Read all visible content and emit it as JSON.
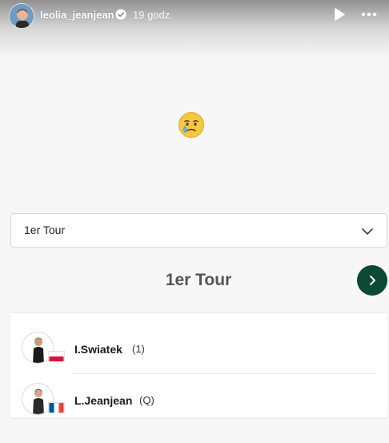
{
  "story": {
    "username": "leolia_jeanjean",
    "time_ago": "19 godz."
  },
  "round_select": {
    "selected": "1er Tour"
  },
  "round_heading": {
    "title": "1er Tour"
  },
  "match": {
    "players": [
      {
        "name": "I.Swiatek",
        "seed": "(1)",
        "flag": "poland-flag-icon"
      },
      {
        "name": "L.Jeanjean",
        "seed": "(Q)",
        "flag": "france-flag-icon"
      }
    ]
  },
  "colors": {
    "accent_green": "#0d4a34",
    "poland_red": "#dc143c",
    "france_blue": "#0055a4",
    "france_red": "#ef4135"
  }
}
